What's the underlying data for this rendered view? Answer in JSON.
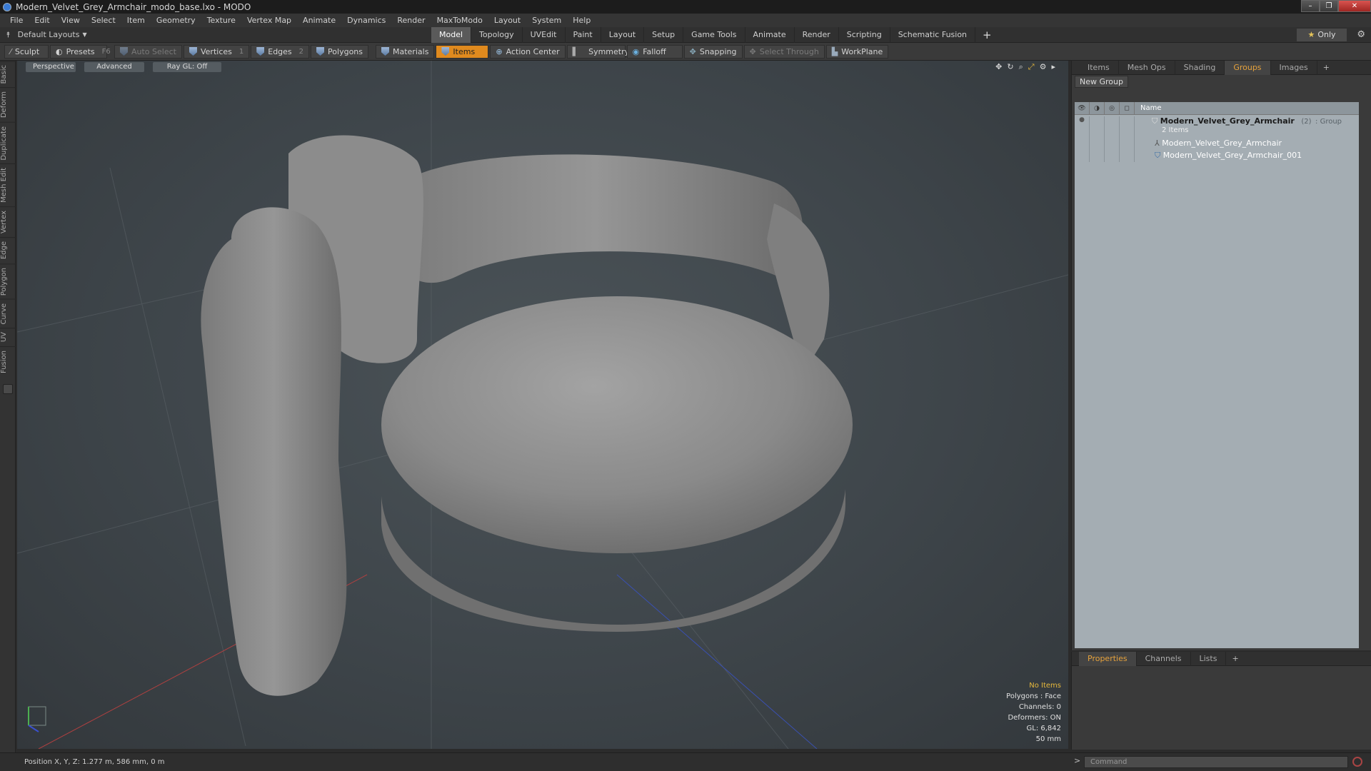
{
  "window": {
    "title": "Modern_Velvet_Grey_Armchair_modo_base.lxo - MODO",
    "controls": [
      "–",
      "❐",
      "✕"
    ]
  },
  "menu": [
    "File",
    "Edit",
    "View",
    "Select",
    "Item",
    "Geometry",
    "Texture",
    "Vertex Map",
    "Animate",
    "Dynamics",
    "Render",
    "MaxToModo",
    "Layout",
    "System",
    "Help"
  ],
  "layouts": {
    "label": "Default Layouts"
  },
  "tabs": [
    "Model",
    "Topology",
    "UVEdit",
    "Paint",
    "Layout",
    "Setup",
    "Game Tools",
    "Animate",
    "Render",
    "Scripting",
    "Schematic Fusion"
  ],
  "only_label": "Only",
  "toolbar": {
    "sculpt": "Sculpt",
    "presets": "Presets",
    "presets_shortcut": "F6",
    "auto_select": "Auto Select",
    "vertices": "Vertices",
    "vertices_count": "1",
    "edges": "Edges",
    "edges_count": "2",
    "polygons": "Polygons",
    "materials": "Materials",
    "items": "Items",
    "action_center": "Action Center",
    "symmetry": "Symmetry",
    "falloff": "Falloff",
    "snapping": "Snapping",
    "select_through": "Select Through",
    "workplane": "WorkPlane"
  },
  "left_tabs": [
    "Basic",
    "Deform",
    "Duplicate",
    "Mesh Edit",
    "Vertex",
    "Edge",
    "Polygon",
    "Curve",
    "UV",
    "Fusion"
  ],
  "viewport": {
    "projection": "Perspective",
    "mode": "Advanced",
    "raygl": "Ray GL: Off",
    "stats": {
      "items": "No Items",
      "polygons": "Polygons : Face",
      "channels": "Channels: 0",
      "deformers": "Deformers: ON",
      "gl": "GL: 6,842",
      "scale": "50 mm"
    }
  },
  "panel_tabs": [
    "Items",
    "Mesh Ops",
    "Shading",
    "Groups",
    "Images"
  ],
  "groups": {
    "new_group": "New Group",
    "name_header": "Name",
    "root": {
      "name": "Modern_Velvet_Grey_Armchair",
      "count": "(2)",
      "type": ": Group",
      "sub": "2 Items"
    },
    "children": [
      "Modern_Velvet_Grey_Armchair",
      "Modern_Velvet_Grey_Armchair_001"
    ]
  },
  "props_tabs": [
    "Properties",
    "Channels",
    "Lists"
  ],
  "status": {
    "position": "Position X, Y, Z:  1.277 m, 586 mm, 0 m",
    "command_placeholder": "Command"
  },
  "colors": {
    "accent": "#e6a23c",
    "items_active": "#e08a1e",
    "viewport_bg": "#40474c"
  }
}
